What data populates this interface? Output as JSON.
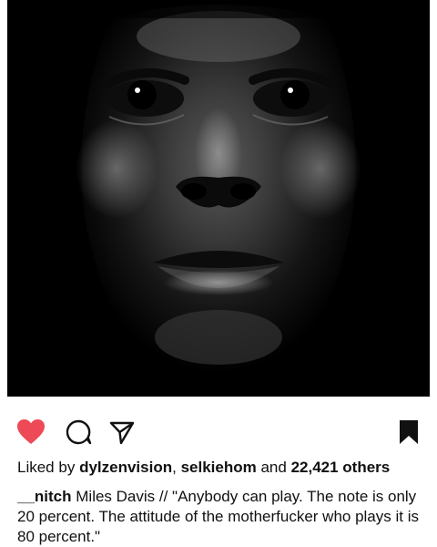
{
  "post": {
    "image": {
      "alt_icon": "portrait-photo",
      "background_color": "#000000"
    },
    "actions": {
      "like_color": "#ed4956",
      "icons": [
        "heart-icon",
        "comment-icon",
        "share-icon",
        "bookmark-icon"
      ]
    },
    "likes": {
      "prefix": "Liked by",
      "user1": "dylzenvision",
      "separator": ",",
      "user2": "selkiehom",
      "and": "and",
      "count_text": "22,421 others"
    },
    "caption": {
      "username": "__nitch",
      "text": "Miles Davis // \"Anybody can play. The note is only 20 percent. The attitude of the motherfucker who plays it is 80 percent.\""
    }
  }
}
